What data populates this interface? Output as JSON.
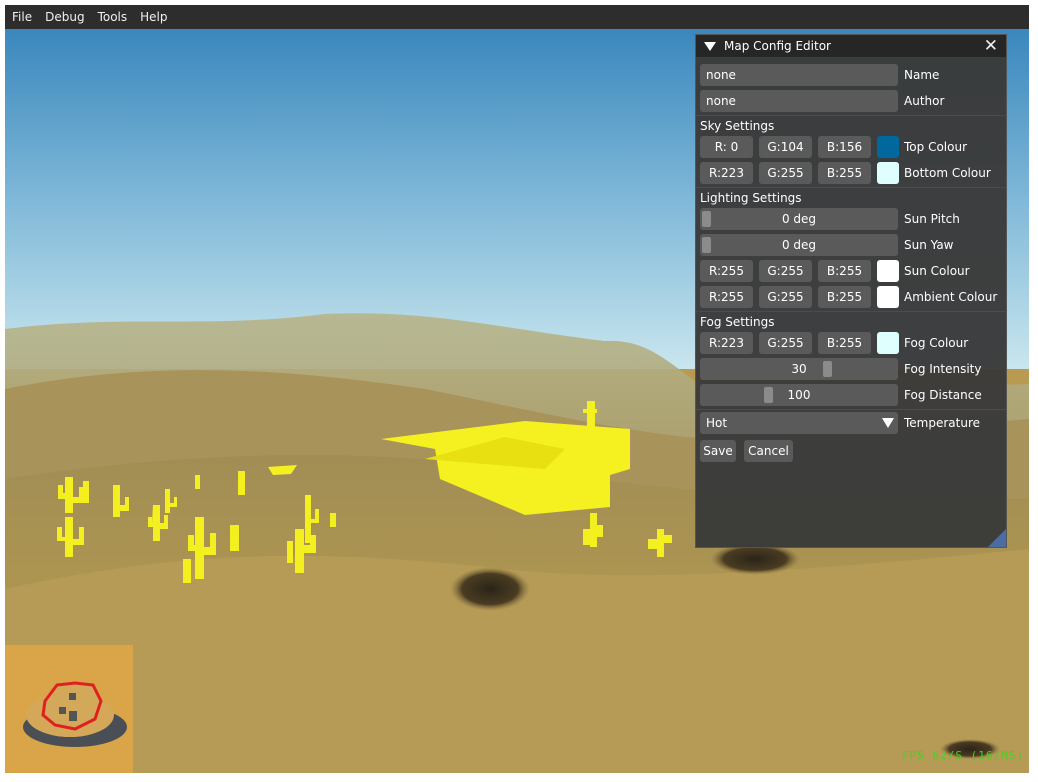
{
  "menu": [
    "File",
    "Debug",
    "Tools",
    "Help"
  ],
  "editor": {
    "title": "Map Config Editor",
    "name_value": "none",
    "name_label": "Name",
    "author_value": "none",
    "author_label": "Author",
    "sky": {
      "heading": "Sky Settings",
      "top": {
        "r": "R:  0",
        "g": "G:104",
        "b": "B:156",
        "label": "Top Colour",
        "swatch": "#00689c"
      },
      "bottom": {
        "r": "R:223",
        "g": "G:255",
        "b": "B:255",
        "label": "Bottom Colour",
        "swatch": "#dfffff"
      }
    },
    "lighting": {
      "heading": "Lighting Settings",
      "pitch_value": "0 deg",
      "pitch_label": "Sun Pitch",
      "yaw_value": "0 deg",
      "yaw_label": "Sun Yaw",
      "sun": {
        "r": "R:255",
        "g": "G:255",
        "b": "B:255",
        "label": "Sun Colour",
        "swatch": "#ffffff"
      },
      "ambient": {
        "r": "R:255",
        "g": "G:255",
        "b": "B:255",
        "label": "Ambient Colour",
        "swatch": "#ffffff"
      }
    },
    "fog": {
      "heading": "Fog Settings",
      "colour": {
        "r": "R:223",
        "g": "G:255",
        "b": "B:255",
        "label": "Fog Colour",
        "swatch": "#dfffff"
      },
      "intensity_value": "30",
      "intensity_label": "Fog Intensity",
      "distance_value": "100",
      "distance_label": "Fog Distance"
    },
    "temperature_value": "Hot",
    "temperature_label": "Temperature",
    "save_label": "Save",
    "cancel_label": "Cancel"
  },
  "fps": "FPS 62/S (16/MS)"
}
